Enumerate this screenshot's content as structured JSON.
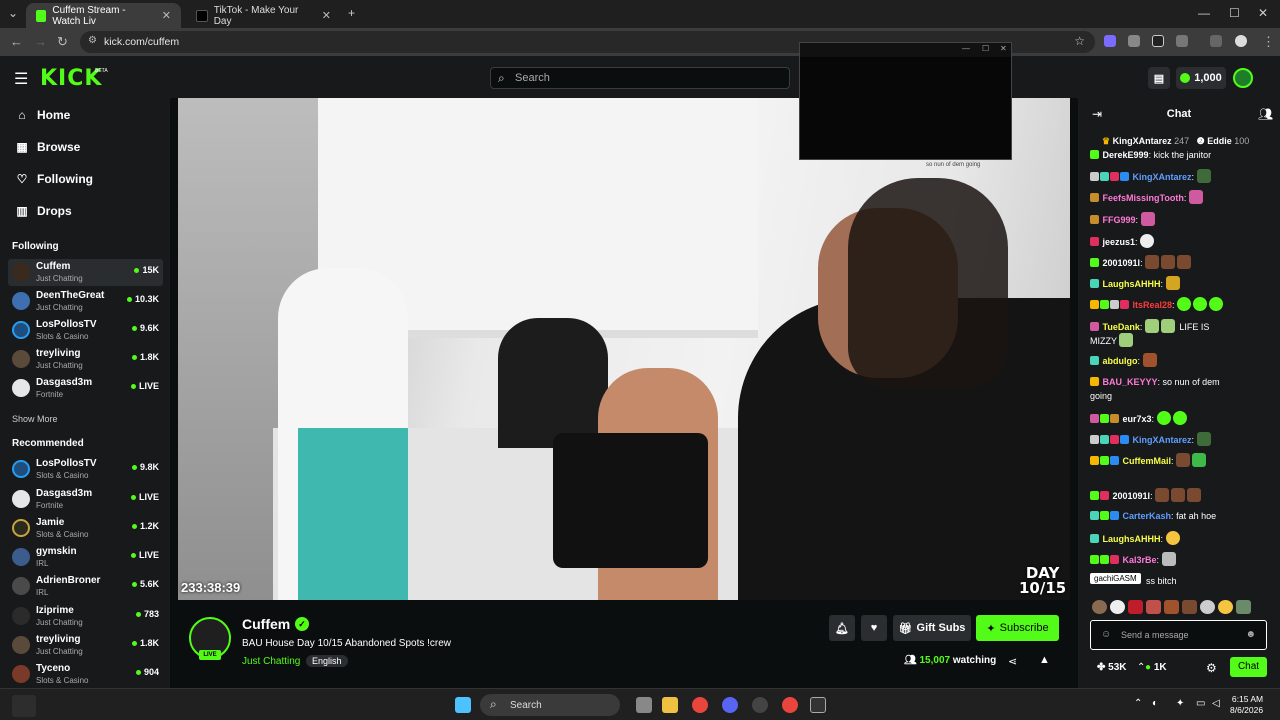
{
  "browser": {
    "tabs": [
      {
        "title": "Cuffem Stream - Watch Liv"
      },
      {
        "title": "TikTok - Make Your Day"
      }
    ],
    "url": "kick.com/cuffem"
  },
  "header": {
    "logo": "KICK",
    "beta": "BETA",
    "search_placeholder": "Search",
    "kicks": "1,000"
  },
  "sidebar": {
    "nav": [
      {
        "label": "Home",
        "icon": "home-icon"
      },
      {
        "label": "Browse",
        "icon": "browse-icon"
      },
      {
        "label": "Following",
        "icon": "heart-icon"
      },
      {
        "label": "Drops",
        "icon": "drops-icon"
      }
    ],
    "following_title": "Following",
    "following": [
      {
        "name": "Cuffem",
        "category": "Just Chatting",
        "viewers": "15K"
      },
      {
        "name": "DeenTheGreat",
        "category": "Just Chatting",
        "viewers": "10.3K"
      },
      {
        "name": "LosPollosTV",
        "category": "Slots & Casino",
        "viewers": "9.6K"
      },
      {
        "name": "treyliving",
        "category": "Just Chatting",
        "viewers": "1.8K"
      },
      {
        "name": "Dasgasd3m",
        "category": "Fortnite",
        "viewers": "LIVE"
      }
    ],
    "show_more": "Show More",
    "recommended_title": "Recommended",
    "recommended": [
      {
        "name": "LosPollosTV",
        "category": "Slots & Casino",
        "viewers": "9.8K"
      },
      {
        "name": "Dasgasd3m",
        "category": "Fortnite",
        "viewers": "LIVE"
      },
      {
        "name": "Jamie",
        "category": "Slots & Casino",
        "viewers": "1.2K"
      },
      {
        "name": "gymskin",
        "category": "IRL",
        "viewers": "LIVE"
      },
      {
        "name": "AdrienBroner",
        "category": "IRL",
        "viewers": "5.6K"
      },
      {
        "name": "Iziprime",
        "category": "Just Chatting",
        "viewers": "783"
      },
      {
        "name": "treyliving",
        "category": "Just Chatting",
        "viewers": "1.8K"
      },
      {
        "name": "Tyceno",
        "category": "Slots & Casino",
        "viewers": "904"
      }
    ]
  },
  "video": {
    "timer": "233:38:39",
    "day_label": "DAY",
    "day_value": "10/15"
  },
  "pip": {
    "caption": "so nun of dem going"
  },
  "stream": {
    "name": "Cuffem",
    "live": "LIVE",
    "title": "BAU House Day 10/15 Abandoned Spots !crew",
    "category": "Just Chatting",
    "language": "English",
    "gift_subs": "Gift Subs",
    "subscribe": "Subscribe",
    "watching_count": "15,007",
    "watching_label": "watching"
  },
  "chat": {
    "title": "Chat",
    "pinned": [
      {
        "name": "KingXAntarez",
        "count": "247"
      },
      {
        "name": "Eddie",
        "count": "100"
      }
    ],
    "messages": [
      {
        "user": "DerekE999",
        "color": "#ffffff",
        "text": "kick the janitor"
      },
      {
        "user": "KingXAntarez",
        "color": "#5f9fff",
        "text": ""
      },
      {
        "user": "FeefsMissingTooth",
        "color": "#ff7ad8",
        "text": ""
      },
      {
        "user": "FFG999",
        "color": "#ff7ad8",
        "text": ""
      },
      {
        "user": "jeezus1",
        "color": "#ffffff",
        "text": ""
      },
      {
        "user": "2001091l",
        "color": "#ffffff",
        "text": ""
      },
      {
        "user": "LaughsAHHH",
        "color": "#f7ff4a",
        "text": ""
      },
      {
        "user": "ItsReal28",
        "color": "#ff3b3b",
        "text": ""
      },
      {
        "user": "TueDank",
        "color": "#f7ff4a",
        "text": "LIFE IS"
      },
      {
        "user": "",
        "color": "#ffffff",
        "text": "MIZZY"
      },
      {
        "user": "abdulgo",
        "color": "#f7ff4a",
        "text": ""
      },
      {
        "user": "BAU_KEYYY",
        "color": "#ff7ad8",
        "text": "so nun of dem"
      },
      {
        "user": "",
        "color": "#ffffff",
        "text": "going"
      },
      {
        "user": "eur7x3",
        "color": "#ffffff",
        "text": ""
      },
      {
        "user": "KingXAntarez",
        "color": "#5f9fff",
        "text": ""
      },
      {
        "user": "CuffemMail",
        "color": "#f7ff4a",
        "text": ""
      },
      {
        "user": "2001091l",
        "color": "#ffffff",
        "text": ""
      },
      {
        "user": "CarterKash",
        "color": "#5f9fff",
        "text": "fat ah hoe"
      },
      {
        "user": "LaughsAHHH",
        "color": "#f7ff4a",
        "text": ""
      },
      {
        "user": "Kal3rBe",
        "color": "#ff7ad8",
        "text": ""
      },
      {
        "user": "",
        "color": "#ffffff",
        "text": "ss bitch"
      }
    ],
    "tooltip": "gachiGASM",
    "input_placeholder": "Send a message",
    "followers": "53K",
    "kicks": "1K",
    "chat_button": "Chat"
  },
  "taskbar": {
    "search": "Search",
    "time": "6:15 AM",
    "date": "8/6/2026"
  },
  "colors": {
    "accent": "#53fc18",
    "background": "#0b0e0f",
    "panel": "#18191b"
  }
}
